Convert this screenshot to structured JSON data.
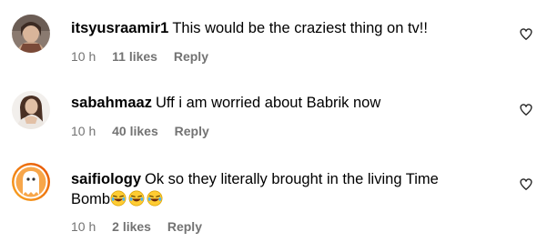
{
  "comments": [
    {
      "username": "itsyusraamir1",
      "text": "This would be the craziest thing on tv!!",
      "time": "10 h",
      "likes": "11 likes",
      "reply": "Reply",
      "avatar_icon": "profile-photo-icon"
    },
    {
      "username": "sabahmaaz",
      "text": "Uff i am worried about Babrik now",
      "time": "10 h",
      "likes": "40 likes",
      "reply": "Reply",
      "avatar_icon": "profile-photo-icon"
    },
    {
      "username": "saifiology",
      "text": "Ok so they literally brought in the living Time",
      "text_line2": "Bomb",
      "emojis": [
        "😂",
        "😂",
        "😂"
      ],
      "time": "10 h",
      "likes": "2 likes",
      "reply": "Reply",
      "avatar_icon": "story-ring-avatar-icon"
    }
  ],
  "colors": {
    "meta_gray": "#737373",
    "story_ring_start": "#f9a825",
    "story_ring_end": "#e65100"
  }
}
